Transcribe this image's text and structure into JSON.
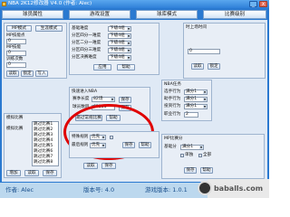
{
  "window": {
    "title": "NBA 2K12修改器 V4.0 (作者: Alec)",
    "min": "_",
    "close": "x"
  },
  "tabs": [
    "球员属性",
    "游戏设置",
    "球库模式",
    "比赛级别"
  ],
  "leftTop": {
    "btns": [
      "MP模式",
      "生涯模式"
    ],
    "labels": [
      "MP技能点",
      "MP技能",
      "训练次数",
      "MP技能"
    ],
    "values": [
      "0",
      "0",
      "0",
      "0"
    ],
    "read": "读取",
    "lock": "锁定",
    "write": "写入"
  },
  "settings": {
    "labels": [
      "基础难度",
      "分区四分一难度",
      "分区二分一难度",
      "分区四分三难度",
      "分区决赛难度"
    ],
    "values": [
      "下级4组",
      "下级4组",
      "下级4组",
      "下级4组",
      "下级4组"
    ],
    "apply": "应用",
    "help": "帮助"
  },
  "time": {
    "label": "时上场时间",
    "value": "0",
    "read": "读取",
    "lock": "锁定"
  },
  "fast": {
    "title": "快速进入NBA",
    "r1_label": "赛季长度",
    "r1_value": "82场",
    "r1_btn": "保存",
    "r2_label": "球员数目",
    "r2_value": "65535",
    "r2_btn": "保存",
    "b1": "跳过常规比赛",
    "b2": "帮助"
  },
  "proBeh": {
    "label": "职业行为",
    "value": "2"
  },
  "nbaTasks": {
    "title": "NBA任务",
    "labels": [
      "选手行为",
      "助手行为",
      "投资行为"
    ],
    "values": [
      "满分1",
      "满分1",
      "满分1"
    ],
    "read": "读取",
    "save": "保存"
  },
  "left2": {
    "title": "模拟比赛",
    "label": "模拟比赛",
    "items": [
      "跳过比赛1",
      "跳过比赛2",
      "跳过比赛3",
      "跳过比赛4",
      "跳过比赛5",
      "跳过比赛6",
      "跳过比赛7",
      "跳过比赛8"
    ],
    "add": "增加",
    "read": "读取",
    "save": "保存"
  },
  "bottom": {
    "labels": [
      "特殊规则",
      "最后规则"
    ],
    "values": [
      "优先",
      "优先"
    ],
    "save": "保存",
    "help": "帮助"
  },
  "rightBottom": {
    "title": "MP比赛分",
    "label": "基础分",
    "value": "满分1",
    "c1": "单独",
    "c2": "全部",
    "save": "保存",
    "help": "帮助"
  },
  "footer": {
    "author": "作者: Alec",
    "version": "版本号: 4.0",
    "game_version": "游戏版本: 1.0.1"
  },
  "watermark": "baballs.com"
}
